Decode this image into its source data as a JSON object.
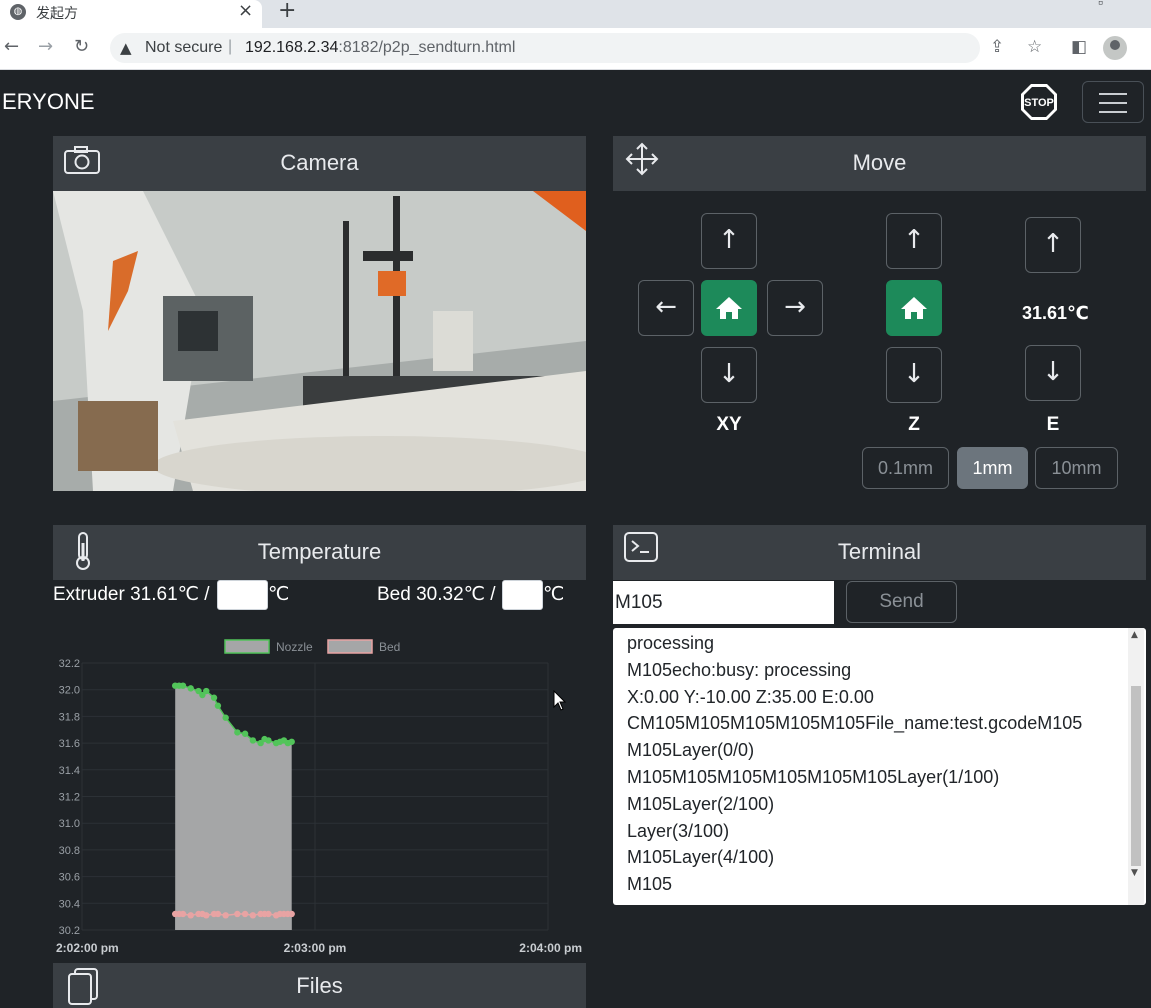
{
  "browser": {
    "tab_title": "发起方",
    "tab_close": "×",
    "new_tab": "+",
    "security_label": "Not secure",
    "url_host": "192.168.2.34",
    "url_rest": ":8182/p2p_sendturn.html"
  },
  "app": {
    "brand": "ERYONE",
    "stop_label": "STOP"
  },
  "camera": {
    "title": "Camera"
  },
  "move": {
    "title": "Move",
    "up": "↑",
    "down": "↓",
    "left": "←",
    "right": "→",
    "xy_label": "XY",
    "z_label": "Z",
    "e_label": "E",
    "e_temp": "31.61℃",
    "steps": [
      "0.1mm",
      "1mm",
      "10mm"
    ],
    "active_step": "1mm"
  },
  "temperature": {
    "title": "Temperature",
    "extruder_label": "Extruder 31.61℃ /",
    "bed_label": "Bed 30.32℃ /",
    "unit": "℃",
    "extruder_target": "",
    "bed_target": ""
  },
  "terminal": {
    "title": "Terminal",
    "input_value": "M105",
    "send_label": "Send",
    "lines": [
      "processing",
      "M105echo:busy: processing",
      "X:0.00 Y:-10.00 Z:35.00 E:0.00",
      "CM105M105M105M105M105File_name:test.gcodeM105",
      "M105Layer(0/0)",
      "M105M105M105M105M105M105Layer(1/100)",
      "M105Layer(2/100)",
      "Layer(3/100)",
      "M105Layer(4/100)",
      "M105"
    ]
  },
  "files": {
    "title": "Files"
  },
  "chart_data": {
    "type": "area",
    "title": "",
    "xlabel": "",
    "ylabel": "",
    "ylim": [
      30.2,
      32.2
    ],
    "yticks": [
      "32.2",
      "32.0",
      "31.8",
      "31.6",
      "31.4",
      "31.2",
      "31.0",
      "30.8",
      "30.6",
      "30.4",
      "30.2"
    ],
    "xticks": [
      "2:02:00 pm",
      "2:03:00 pm",
      "2:04:00 pm"
    ],
    "x_range_seconds": [
      0,
      120
    ],
    "legend_position": "top",
    "series": [
      {
        "name": "Nozzle",
        "color": "#52c45a",
        "x": [
          24,
          25,
          26,
          28,
          30,
          31,
          32,
          34,
          35,
          37,
          40,
          42,
          44,
          46,
          47,
          48,
          50,
          51,
          52,
          53,
          54
        ],
        "y": [
          32.03,
          32.03,
          32.03,
          32.01,
          31.99,
          31.96,
          31.99,
          31.94,
          31.88,
          31.79,
          31.68,
          31.67,
          31.62,
          31.6,
          31.63,
          31.62,
          31.6,
          31.61,
          31.62,
          31.6,
          31.61
        ]
      },
      {
        "name": "Bed",
        "color": "#e8a3a3",
        "x": [
          24,
          25,
          26,
          28,
          30,
          31,
          32,
          34,
          35,
          37,
          40,
          42,
          44,
          46,
          47,
          48,
          50,
          51,
          52,
          53,
          54
        ],
        "y": [
          30.32,
          30.32,
          30.32,
          30.31,
          30.32,
          30.32,
          30.31,
          30.32,
          30.32,
          30.31,
          30.32,
          30.32,
          30.31,
          30.32,
          30.32,
          30.32,
          30.31,
          30.32,
          30.32,
          30.32,
          30.32
        ]
      }
    ]
  }
}
